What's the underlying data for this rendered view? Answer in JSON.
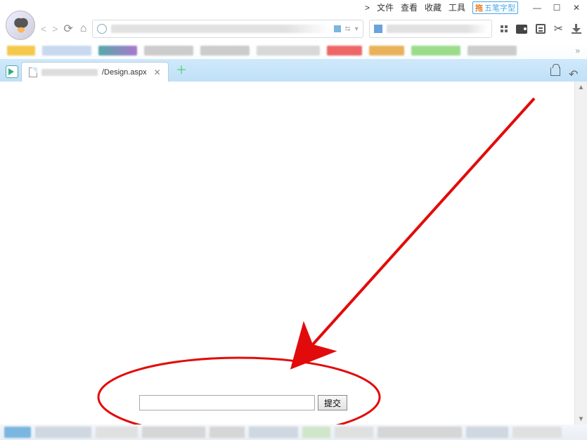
{
  "menubar": {
    "file": "文件",
    "view": "查看",
    "favorites": "收藏",
    "tools": "工具",
    "ime_label": "五笔字型"
  },
  "tab": {
    "suffix": "/Design.aspx"
  },
  "form": {
    "input_value": "",
    "submit_label": "提交"
  }
}
